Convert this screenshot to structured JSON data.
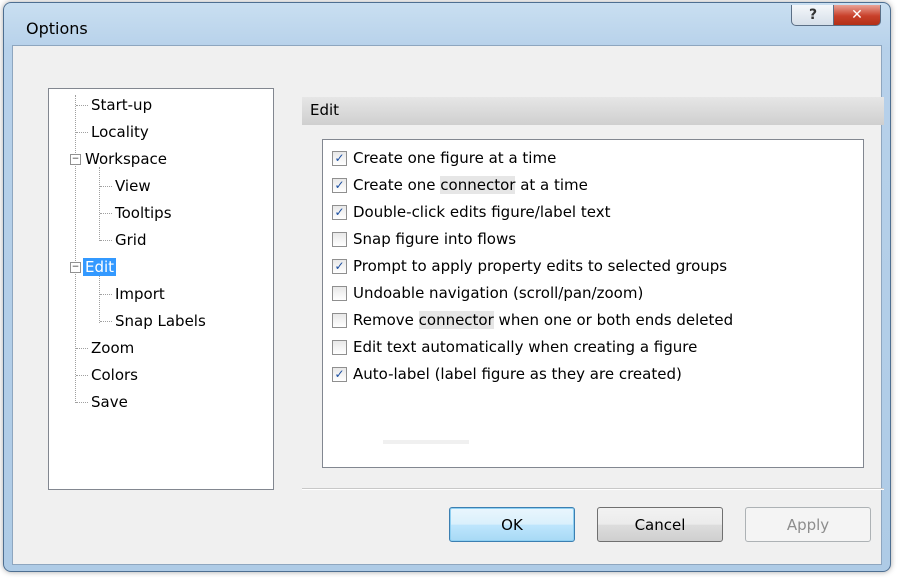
{
  "window": {
    "title": "Options"
  },
  "titlebar": {
    "help_label": "?",
    "close_label": "✕"
  },
  "tree": {
    "items": [
      {
        "label": "Start-up"
      },
      {
        "label": "Locality"
      },
      {
        "label": "Workspace",
        "expander": "−"
      },
      {
        "label": "View"
      },
      {
        "label": "Tooltips"
      },
      {
        "label": "Grid"
      },
      {
        "label": "Edit",
        "expander": "−",
        "selected": true
      },
      {
        "label": "Import"
      },
      {
        "label": "Snap Labels"
      },
      {
        "label": "Zoom"
      },
      {
        "label": "Colors"
      },
      {
        "label": "Save"
      }
    ]
  },
  "section": {
    "title": "Edit"
  },
  "options": [
    {
      "before": "Create one figure at a time",
      "hl": "",
      "after": "",
      "checked": true
    },
    {
      "before": "Create one ",
      "hl": "connector",
      "after": " at a time",
      "checked": true
    },
    {
      "before": "Double-click edits figure/label text",
      "hl": "",
      "after": "",
      "checked": true
    },
    {
      "before": "Snap figure into flows",
      "hl": "",
      "after": "",
      "checked": false
    },
    {
      "before": "Prompt to apply property edits to selected groups",
      "hl": "",
      "after": "",
      "checked": true
    },
    {
      "before": "Undoable navigation (scroll/pan/zoom)",
      "hl": "",
      "after": "",
      "checked": false
    },
    {
      "before": "Remove ",
      "hl": "connector",
      "after": " when one or both ends deleted",
      "checked": false
    },
    {
      "before": "Edit text automatically when creating a figure",
      "hl": "",
      "after": "",
      "checked": false
    },
    {
      "before": "Auto-label (label figure as they are created)",
      "hl": "",
      "after": "",
      "checked": true
    }
  ],
  "buttons": {
    "ok": "OK",
    "cancel": "Cancel",
    "apply": "Apply"
  },
  "checkmark": "✓"
}
